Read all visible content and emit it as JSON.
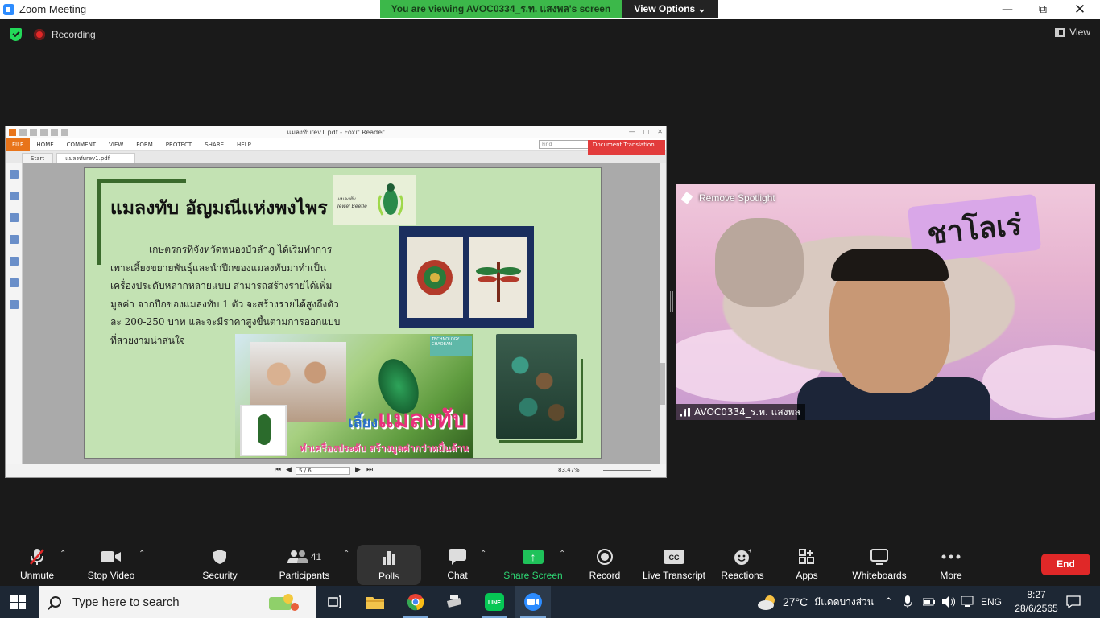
{
  "window": {
    "title": "Zoom Meeting",
    "viewing_banner": "You are viewing AVOC0334_ร.ท. แสงพล's screen",
    "view_options": "View Options ⌄"
  },
  "topbar": {
    "recording_label": "Recording",
    "view_label": "View"
  },
  "foxit": {
    "window_title": "แมลงทับrev1.pdf - Foxit Reader",
    "menu": [
      "FILE",
      "HOME",
      "COMMENT",
      "VIEW",
      "FORM",
      "PROTECT",
      "SHARE",
      "HELP"
    ],
    "find_placeholder": "Find",
    "tabs": [
      "Start",
      "แมลงทับrev1.pdf"
    ],
    "doc_translation": "Document Translation",
    "page_indicator": "5 / 6",
    "zoom": "83.47%"
  },
  "pdf_page": {
    "title": "แมลงทับ อัญมณีแห่งพงไพร",
    "body": "เกษตรกรที่จังหวัดหนองบัวลำภู ได้เริ่มทำการเพาะเลี้ยงขยายพันธุ์และนำปีกของแมลงทับมาทำเป็นเครื่องประดับหลากหลายแบบ สามารถสร้างรายได้เพิ่มมูลค่า จากปีกของแมลงทับ 1 ตัว จะสร้างรายได้สูงถึงตัวละ 200-250 บาท และจะมีราคาสูงขึ้นตามการออกแบบที่สวยงามน่าสนใจ",
    "logo_text_1": "แมลงทับ",
    "logo_text_2": "Jewel Beetle",
    "tech_badge": "TECHNOLOGY CHAOBAN",
    "banner_big_1": "เลี้ยง",
    "banner_big_2": "แมลงทับ",
    "banner_sub": "ทำเครื่องประดับ สร้างมูลค่ากว่าหมื่นล้าน"
  },
  "video": {
    "remove_spotlight": "Remove Spotlight",
    "sticker_text": "ชาโลเร่",
    "participant_name": "AVOC0334_ร.ท. แสงพล"
  },
  "toolbar": {
    "unmute": "Unmute",
    "stop_video": "Stop Video",
    "security": "Security",
    "participants": "Participants",
    "participants_count": "41",
    "polls": "Polls",
    "chat": "Chat",
    "share_screen": "Share Screen",
    "record": "Record",
    "live_transcript": "Live Transcript",
    "reactions": "Reactions",
    "apps": "Apps",
    "whiteboards": "Whiteboards",
    "more": "More",
    "end": "End"
  },
  "taskbar": {
    "search_placeholder": "Type here to search",
    "temperature": "27°C",
    "weather": "มีแดดบางส่วน",
    "language": "ENG",
    "time": "8:27",
    "date": "28/6/2565"
  },
  "colors": {
    "zoom_green": "#3cb84a",
    "end_red": "#e02828",
    "foxit_orange": "#e8741a",
    "pdf_bg": "#c3e2b3"
  }
}
